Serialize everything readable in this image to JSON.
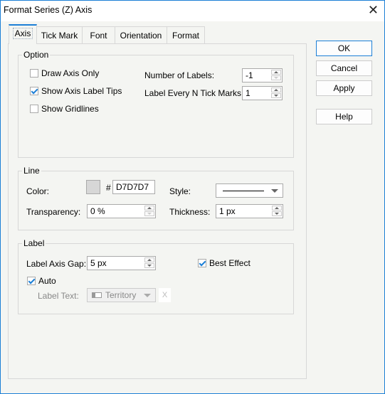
{
  "window": {
    "title": "Format Series (Z) Axis",
    "close_glyph": "✕"
  },
  "tabs": [
    {
      "label": "Axis",
      "active": true
    },
    {
      "label": "Tick Mark",
      "active": false
    },
    {
      "label": "Font",
      "active": false
    },
    {
      "label": "Orientation",
      "active": false
    },
    {
      "label": "Format",
      "active": false
    }
  ],
  "option": {
    "title": "Option",
    "draw_axis_only": {
      "label": "Draw Axis Only",
      "checked": false
    },
    "show_axis_label_tips": {
      "label": "Show Axis Label Tips",
      "checked": true
    },
    "show_gridlines": {
      "label": "Show Gridlines",
      "checked": false
    },
    "number_of_labels": {
      "label": "Number of Labels:",
      "value": "-1"
    },
    "label_every_n": {
      "label": "Label Every N Tick Marks:",
      "value": "1"
    }
  },
  "line": {
    "title": "Line",
    "color_label": "Color:",
    "color_hash": "#",
    "color_value": "D7D7D7",
    "color_swatch": "#d7d7d7",
    "style_label": "Style:",
    "style_value": "solid",
    "transparency_label": "Transparency:",
    "transparency_value": "0 %",
    "thickness_label": "Thickness:",
    "thickness_value": "1 px"
  },
  "label": {
    "title": "Label",
    "axis_gap_label": "Label Axis Gap:",
    "axis_gap_value": "5 px",
    "best_effect": {
      "label": "Best Effect",
      "checked": true
    },
    "auto": {
      "label": "Auto",
      "checked": true
    },
    "label_text_label": "Label Text:",
    "label_text_value": "Territory",
    "clear_glyph": "X"
  },
  "buttons": {
    "ok": "OK",
    "cancel": "Cancel",
    "apply": "Apply",
    "help": "Help"
  }
}
